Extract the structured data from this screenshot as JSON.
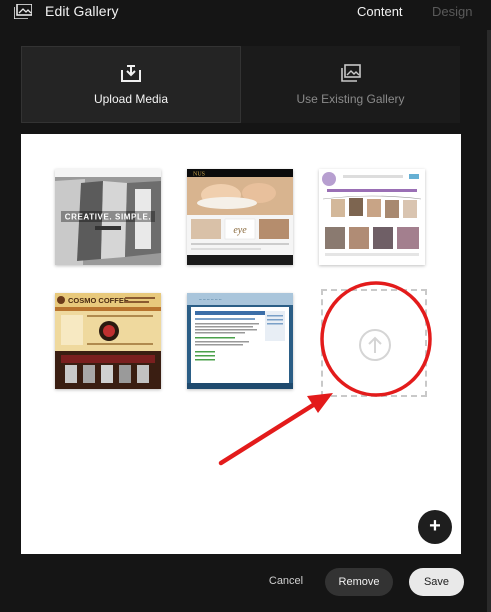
{
  "header": {
    "title": "Edit Gallery",
    "tabs": [
      {
        "label": "Content",
        "active": true
      },
      {
        "label": "Design",
        "active": false
      }
    ]
  },
  "source_tabs": {
    "upload_label": "Upload Media",
    "existing_label": "Use Existing Gallery",
    "upload_icon": "upload-tray-icon",
    "existing_icon": "gallery-images-icon"
  },
  "thumbnails": [
    {
      "name": "bydi-creative-simple",
      "caption": "CREATIVE. SIMPLE."
    },
    {
      "name": "spa-site",
      "caption": "eye"
    },
    {
      "name": "photo-clothesline-site",
      "caption": ""
    },
    {
      "name": "cosmo-coffee",
      "caption": "COSMO COFFEE"
    },
    {
      "name": "blue-text-site",
      "caption": ""
    }
  ],
  "dropzone": {
    "icon": "upload-arrow-icon"
  },
  "add_button": {
    "icon": "plus-icon",
    "label": "+"
  },
  "footer": {
    "cancel_label": "Cancel",
    "remove_label": "Remove",
    "save_label": "Save"
  },
  "annotation": {
    "color": "#e31b1b"
  },
  "colors": {
    "background": "#151515",
    "panel": "#ffffff",
    "accent_red": "#e31b1b"
  }
}
